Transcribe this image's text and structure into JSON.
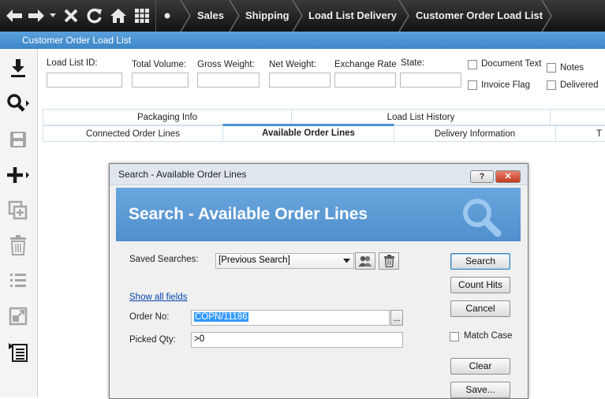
{
  "breadcrumb": [
    "Sales",
    "Shipping",
    "Load List Delivery",
    "Customer Order Load List"
  ],
  "window_title": "Customer Order Load List",
  "header_fields": [
    {
      "label": "Load List ID:",
      "value": ""
    },
    {
      "label": "Total Volume:",
      "value": ""
    },
    {
      "label": "Gross Weight:",
      "value": ""
    },
    {
      "label": "Net Weight:",
      "value": ""
    },
    {
      "label": "Exchange Rate",
      "value": ""
    },
    {
      "label": "State:",
      "value": ""
    }
  ],
  "checkboxes": [
    {
      "label": "Document Text",
      "checked": false
    },
    {
      "label": "Notes",
      "checked": false
    },
    {
      "label": "Invoice Flag",
      "checked": false
    },
    {
      "label": "Delivered",
      "checked": false
    }
  ],
  "tabs_row1": [
    "Packaging Info",
    "Load List History"
  ],
  "tabs_row2": [
    "Connected Order Lines",
    "Available Order Lines",
    "Delivery Information",
    "T"
  ],
  "active_tab": "Available Order Lines",
  "dialog": {
    "title": "Search - Available Order Lines",
    "header_title": "Search - Available Order Lines",
    "saved_searches_label": "Saved Searches:",
    "saved_searches_value": "[Previous Search]",
    "show_all_fields": "Show all fields",
    "order_no_label": "Order No:",
    "order_no_value": "COPN/11186",
    "picked_qty_label": "Picked Qty:",
    "picked_qty_value": ">0",
    "match_case_label": "Match Case",
    "match_case_checked": false,
    "buttons": {
      "search": "Search",
      "count_hits": "Count Hits",
      "cancel": "Cancel",
      "clear": "Clear",
      "save": "Save..."
    },
    "help_button": "?",
    "close_button": "✕",
    "browse_button": "..."
  },
  "colors": {
    "accent": "#4a90d0",
    "titlebar": "#3d86c8",
    "toolbar": "#1c1c1c"
  }
}
